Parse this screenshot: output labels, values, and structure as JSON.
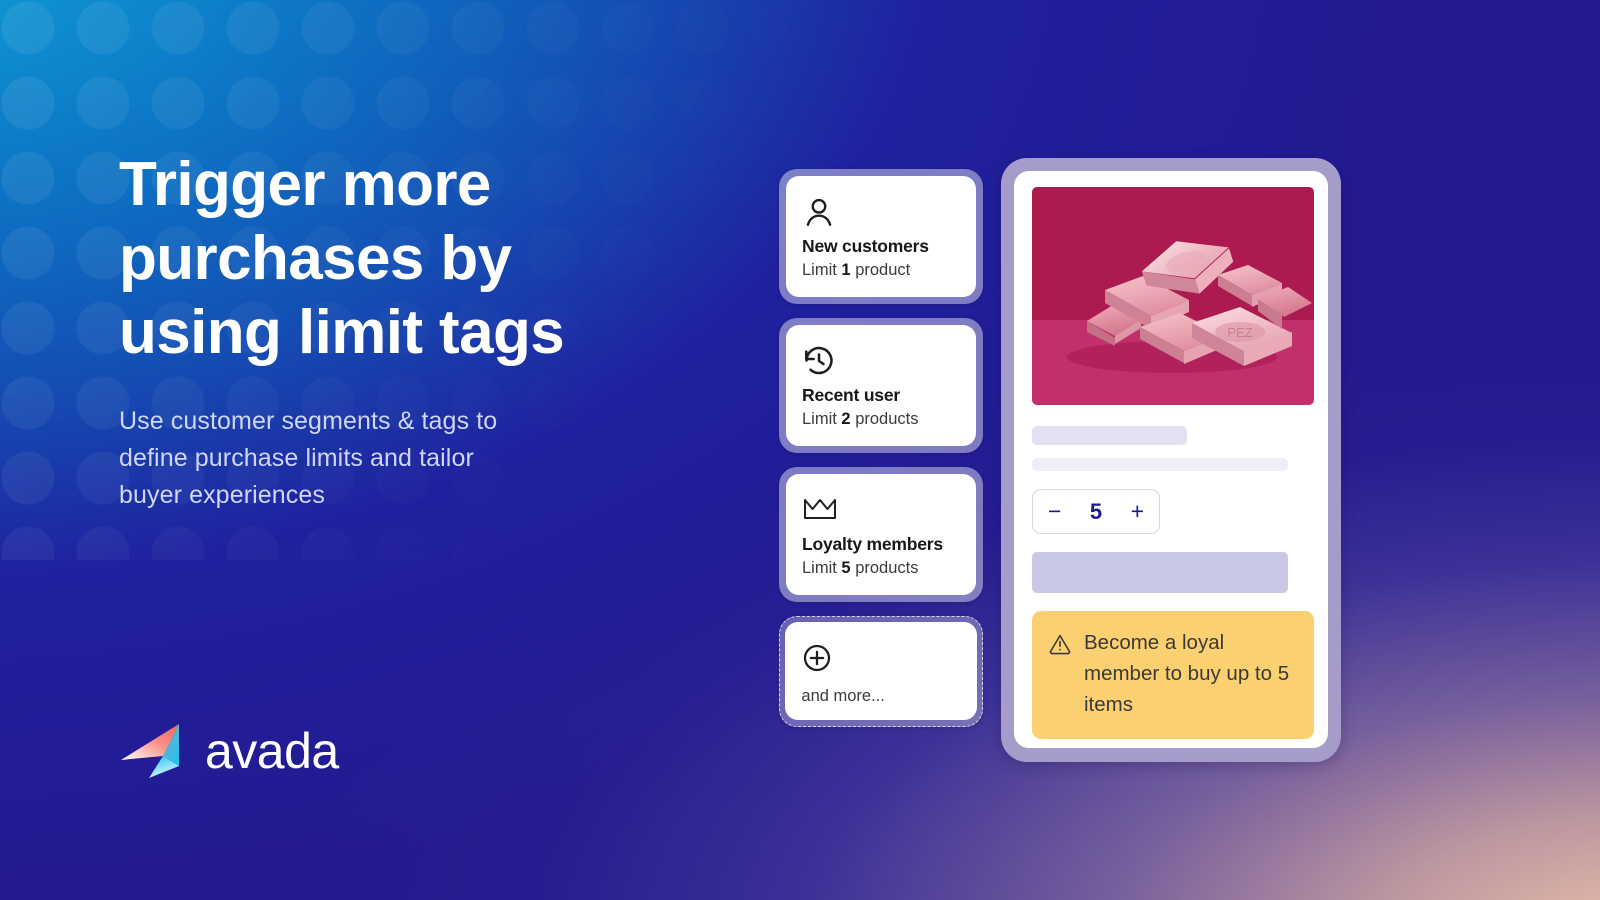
{
  "hero": {
    "headline": "Trigger more\npurchases by\nusing limit tags",
    "subhead": "Use customer segments & tags to\ndefine purchase limits and tailor\nbuyer experiences"
  },
  "brand": {
    "name": "avada",
    "logo_gradient_from": "#f9776f",
    "logo_gradient_to": "#22c8f5"
  },
  "cards": [
    {
      "icon": "person-icon",
      "title": "New customers",
      "limit_prefix": "Limit ",
      "limit_value": "1",
      "limit_suffix": " product"
    },
    {
      "icon": "history-clock-icon",
      "title": "Recent user",
      "limit_prefix": "Limit ",
      "limit_value": "2",
      "limit_suffix": " products"
    },
    {
      "icon": "crown-icon",
      "title": "Loyalty members",
      "limit_prefix": "Limit ",
      "limit_value": "5",
      "limit_suffix": " products"
    },
    {
      "icon": "plus-circle-icon",
      "title": "and more..."
    }
  ],
  "phone": {
    "product_image_alt": "pink candy pieces",
    "quantity": {
      "decrement_label": "−",
      "value": "5",
      "increment_label": "+"
    },
    "notice": {
      "icon": "warning-triangle-icon",
      "text": "Become a loyal member to buy up to 5 items",
      "background": "#fbd071"
    }
  },
  "colors": {
    "bg_blue": "#1350b4",
    "bg_navy": "#231a90",
    "bg_cyan": "#0f9fd8",
    "bg_peach": "#f4c9aa",
    "card_frame": "#a69cca",
    "stepper_text": "#1c1a8a"
  }
}
